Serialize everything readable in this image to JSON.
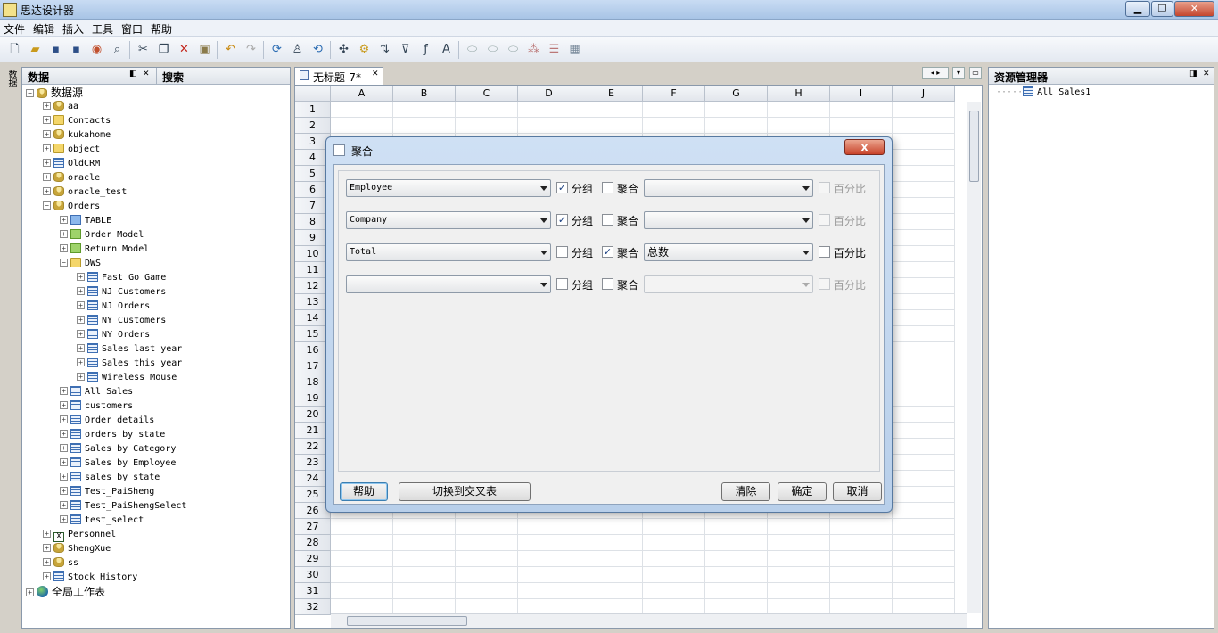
{
  "window": {
    "title": "思达设计器",
    "min_label": "▁",
    "max_label": "❐",
    "close_label": "✕"
  },
  "menu": [
    "文件",
    "编辑",
    "插入",
    "工具",
    "窗口",
    "帮助"
  ],
  "side_vtab": "数据",
  "data_panel": {
    "title": "数据",
    "search_tab": "搜索"
  },
  "tree": [
    {
      "label": "数据源",
      "level": 0,
      "icon": "db",
      "expander": "-"
    },
    {
      "label": "aa",
      "level": 1,
      "icon": "db",
      "expander": "+"
    },
    {
      "label": "Contacts",
      "level": 1,
      "icon": "fld",
      "expander": "+"
    },
    {
      "label": "kukahome",
      "level": 1,
      "icon": "db",
      "expander": "+"
    },
    {
      "label": "object",
      "level": 1,
      "icon": "fld",
      "expander": "+"
    },
    {
      "label": "OldCRM",
      "level": 1,
      "icon": "tbl",
      "expander": "+"
    },
    {
      "label": "oracle",
      "level": 1,
      "icon": "db",
      "expander": "+"
    },
    {
      "label": "oracle_test",
      "level": 1,
      "icon": "db",
      "expander": "+"
    },
    {
      "label": "Orders",
      "level": 1,
      "icon": "db",
      "expander": "-"
    },
    {
      "label": "TABLE",
      "level": 2,
      "icon": "fldb",
      "expander": "+"
    },
    {
      "label": "Order Model",
      "level": 2,
      "icon": "fldg",
      "expander": "+"
    },
    {
      "label": "Return Model",
      "level": 2,
      "icon": "fldg",
      "expander": "+"
    },
    {
      "label": "DWS",
      "level": 2,
      "icon": "fld",
      "expander": "-"
    },
    {
      "label": "Fast Go Game",
      "level": 3,
      "icon": "tbl",
      "expander": "+"
    },
    {
      "label": "NJ Customers",
      "level": 3,
      "icon": "tbl",
      "expander": "+"
    },
    {
      "label": "NJ Orders",
      "level": 3,
      "icon": "tbl",
      "expander": "+"
    },
    {
      "label": "NY Customers",
      "level": 3,
      "icon": "tbl",
      "expander": "+"
    },
    {
      "label": "NY Orders",
      "level": 3,
      "icon": "tbl",
      "expander": "+"
    },
    {
      "label": "Sales last year",
      "level": 3,
      "icon": "tbl",
      "expander": "+"
    },
    {
      "label": "Sales this year",
      "level": 3,
      "icon": "tbl",
      "expander": "+"
    },
    {
      "label": "Wireless Mouse",
      "level": 3,
      "icon": "tbl",
      "expander": "+"
    },
    {
      "label": "All Sales",
      "level": 2,
      "icon": "tbl",
      "expander": "+"
    },
    {
      "label": "customers",
      "level": 2,
      "icon": "tbl",
      "expander": "+"
    },
    {
      "label": "Order details",
      "level": 2,
      "icon": "tbl",
      "expander": "+"
    },
    {
      "label": "orders by state",
      "level": 2,
      "icon": "tbl",
      "expander": "+"
    },
    {
      "label": "Sales by Category",
      "level": 2,
      "icon": "tbl",
      "expander": "+"
    },
    {
      "label": "Sales by Employee",
      "level": 2,
      "icon": "tbl",
      "expander": "+"
    },
    {
      "label": "sales by state",
      "level": 2,
      "icon": "tbl",
      "expander": "+"
    },
    {
      "label": "Test_PaiSheng",
      "level": 2,
      "icon": "tbl",
      "expander": "+"
    },
    {
      "label": "Test_PaiShengSelect",
      "level": 2,
      "icon": "tbl",
      "expander": "+"
    },
    {
      "label": "test_select",
      "level": 2,
      "icon": "tbl",
      "expander": "+"
    },
    {
      "label": "Personnel",
      "level": 1,
      "icon": "xl",
      "expander": "+"
    },
    {
      "label": "ShengXue",
      "level": 1,
      "icon": "db",
      "expander": "+"
    },
    {
      "label": "ss",
      "level": 1,
      "icon": "db",
      "expander": "+"
    },
    {
      "label": "Stock History",
      "level": 1,
      "icon": "tbl",
      "expander": "+"
    },
    {
      "label": "全局工作表",
      "level": 0,
      "icon": "globe",
      "expander": "+"
    }
  ],
  "doc_tab": {
    "title": "无标题-7*"
  },
  "columns": [
    "A",
    "B",
    "C",
    "D",
    "E",
    "F",
    "G",
    "H",
    "I",
    "J"
  ],
  "rows": [
    "1",
    "2",
    "3",
    "4",
    "5",
    "6",
    "7",
    "8",
    "9",
    "10",
    "11",
    "12",
    "13",
    "14",
    "15",
    "16",
    "17",
    "18",
    "19",
    "20",
    "21",
    "22",
    "23",
    "24",
    "25",
    "26",
    "27",
    "28",
    "29",
    "30",
    "31",
    "32"
  ],
  "resource_panel": {
    "title": "资源管理器",
    "items": [
      "All Sales1"
    ]
  },
  "dialog": {
    "title": "聚合",
    "close_label": "x",
    "group_label": "分组",
    "agg_label": "聚合",
    "percent_label": "百分比",
    "rows": [
      {
        "field": "Employee",
        "group": true,
        "agg": false,
        "func": "",
        "func_enabled": true,
        "percent": false
      },
      {
        "field": "Company",
        "group": true,
        "agg": false,
        "func": "",
        "func_enabled": true,
        "percent": false
      },
      {
        "field": "Total",
        "group": false,
        "agg": true,
        "func": "总数",
        "func_enabled": true,
        "percent": false
      },
      {
        "field": "",
        "group": false,
        "agg": false,
        "func": "",
        "func_enabled": false,
        "percent": false
      }
    ],
    "buttons": {
      "help": "帮助",
      "switch": "切换到交叉表",
      "clear": "清除",
      "ok": "确定",
      "cancel": "取消"
    }
  }
}
